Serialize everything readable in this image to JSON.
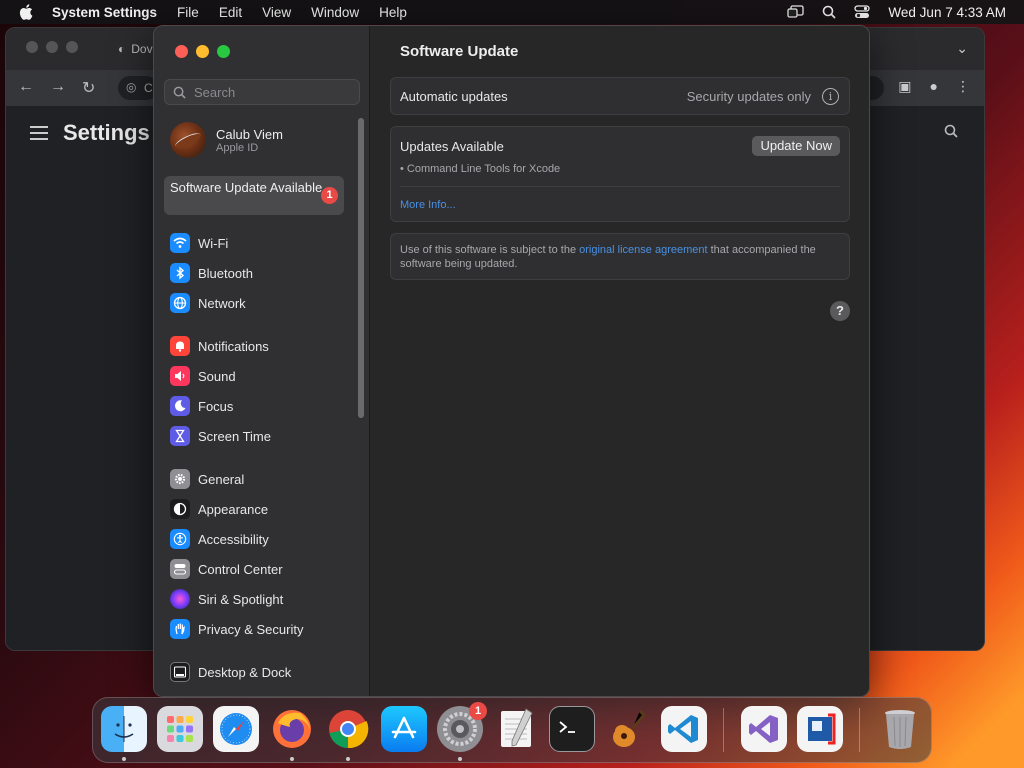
{
  "menubar": {
    "app_name": "System Settings",
    "menus": [
      "File",
      "Edit",
      "View",
      "Window",
      "Help"
    ],
    "clock": "Wed Jun 7  4:33 AM"
  },
  "background_window": {
    "tab_title": "Dov",
    "omnibox_text": "C",
    "page_title": "Settings"
  },
  "sidebar": {
    "search_placeholder": "Search",
    "account_name": "Calub Viem",
    "account_sub": "Apple ID",
    "update_item": {
      "label": "Software Update Available",
      "badge": "1"
    },
    "items": [
      {
        "label": "Wi-Fi",
        "icon": "wifi-icon",
        "color": "#1a8cff"
      },
      {
        "label": "Bluetooth",
        "icon": "bluetooth-icon",
        "color": "#1a8cff"
      },
      {
        "label": "Network",
        "icon": "globe-icon",
        "color": "#1a8cff"
      },
      {
        "label": "Notifications",
        "icon": "bell-icon",
        "color": "#ff453a"
      },
      {
        "label": "Sound",
        "icon": "speaker-icon",
        "color": "#ff375f"
      },
      {
        "label": "Focus",
        "icon": "moon-icon",
        "color": "#5e5ce6"
      },
      {
        "label": "Screen Time",
        "icon": "hourglass-icon",
        "color": "#5e5ce6"
      },
      {
        "label": "General",
        "icon": "gear-icon",
        "color": "#8e8e93"
      },
      {
        "label": "Appearance",
        "icon": "appearance-icon",
        "color": "#1c1c1e"
      },
      {
        "label": "Accessibility",
        "icon": "accessibility-icon",
        "color": "#1a8cff"
      },
      {
        "label": "Control Center",
        "icon": "toggles-icon",
        "color": "#8e8e93"
      },
      {
        "label": "Siri & Spotlight",
        "icon": "siri-icon",
        "color": "#bf5af2"
      },
      {
        "label": "Privacy & Security",
        "icon": "hand-icon",
        "color": "#1a8cff"
      },
      {
        "label": "Desktop & Dock",
        "icon": "dock-icon",
        "color": "#1c1c1e"
      }
    ]
  },
  "main": {
    "title": "Software Update",
    "auto_updates_label": "Automatic updates",
    "auto_updates_value": "Security updates only",
    "updates_label": "Updates Available",
    "update_now": "Update Now",
    "package": "• Command Line Tools for Xcode",
    "more_info": "More Info...",
    "license_pre": "Use of this software is subject to the ",
    "license_link": "original license agreement",
    "license_post": " that accompanied the software being updated.",
    "help": "?"
  },
  "dock": {
    "apps": [
      "finder-icon",
      "launchpad-icon",
      "safari-icon",
      "firefox-icon",
      "chrome-icon",
      "app-store-icon",
      "system-settings-icon",
      "textedit-icon",
      "terminal-icon",
      "garageband-icon",
      "vscode-icon",
      "visual-studio-icon",
      "parallels-icon",
      "trash-icon"
    ],
    "settings_badge": "1"
  }
}
